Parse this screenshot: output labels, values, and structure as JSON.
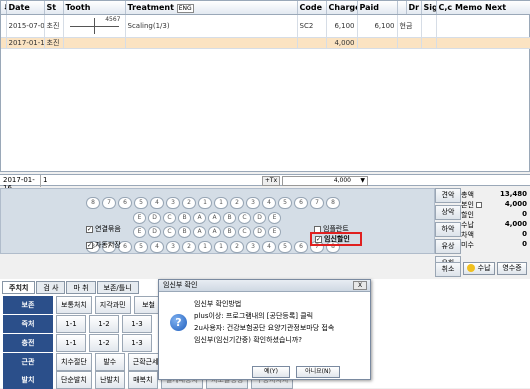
{
  "table": {
    "headers": {
      "arrow": "⬇",
      "date": "Date",
      "st": "St",
      "tooth": "Tooth",
      "treatment": "Treatment",
      "eng": "ENG",
      "code": "Code",
      "charge": "Charge",
      "paid": "Paid",
      "dr": "Dr",
      "sign": "Sign",
      "memo": "C,c Memo Next"
    },
    "rows": [
      {
        "date": "2015-07-06",
        "st": "초진",
        "tooth_num": "4567",
        "treatment": "Scaling(1/3)",
        "code": "SC2",
        "charge": "6,100",
        "paid": "6,100",
        "pay_method": "현금"
      },
      {
        "date": "2017-01-16",
        "st": "초진",
        "tooth_num": "",
        "treatment": "",
        "code": "",
        "charge": "4,000",
        "paid": "",
        "pay_method": ""
      }
    ]
  },
  "input_row": {
    "date": "2017-01-16",
    "count": "1",
    "tx_button": "+Tx",
    "amount": "4,000"
  },
  "chart": {
    "upper_teeth": [
      "8",
      "7",
      "6",
      "5",
      "4",
      "3",
      "2",
      "1",
      "1",
      "2",
      "3",
      "4",
      "5",
      "6",
      "7",
      "8"
    ],
    "upper_primary": [
      "E",
      "D",
      "C",
      "B",
      "A",
      "A",
      "B",
      "C",
      "D",
      "E"
    ],
    "lower_primary": [
      "E",
      "D",
      "C",
      "B",
      "A",
      "A",
      "B",
      "C",
      "D",
      "E"
    ],
    "lower_teeth": [
      "8",
      "7",
      "6",
      "5",
      "4",
      "3",
      "2",
      "1",
      "1",
      "2",
      "3",
      "4",
      "5",
      "6",
      "7",
      "8"
    ],
    "check_continuous": "연결묶음",
    "check_autosave": "자동저장",
    "check_implant": "임플란트",
    "check_pregnancy": "임신할인"
  },
  "side_buttons": [
    "견악",
    "상악",
    "하악",
    "유상",
    "유하",
    "취소"
  ],
  "totals": [
    {
      "label": "총액",
      "value": "13,480"
    },
    {
      "label": "본인",
      "value": "4,000"
    },
    {
      "label": "할인",
      "value": "0"
    },
    {
      "label": "수납",
      "value": "4,000"
    },
    {
      "label": "차액",
      "value": "0"
    },
    {
      "label": "미수",
      "value": "0"
    }
  ],
  "bottom_buttons": {
    "pay": "수납",
    "receipt": "영수증"
  },
  "tabs": [
    "주치치",
    "검 사",
    "마 취",
    "보존/틀니"
  ],
  "categories": [
    {
      "label": "보존",
      "buttons": [
        "보통처치",
        "지각과민",
        "보철"
      ]
    },
    {
      "label": "즉처",
      "buttons": [
        "1-1",
        "1-2",
        "1-3"
      ]
    },
    {
      "label": "충전",
      "buttons": [
        "1-1",
        "1-2",
        "1-3"
      ]
    },
    {
      "label": "근관",
      "buttons": [
        "치수절단",
        "발수",
        "근확근세"
      ]
    },
    {
      "label": "발치",
      "buttons": [
        "단순발치",
        "난발치",
        "매복치",
        "절개배농치",
        "치조골성형",
        "구동치치치"
      ]
    }
  ],
  "dialog": {
    "title": "임신부 확인",
    "close": "X",
    "icon": "?",
    "lines": [
      "임신부 확인방법",
      "plus이상: 프로그램내의 [공단등록] 클릭",
      "2u사용자: 건강보험공단 요양기관정보마당 접속",
      "임신부(임신기간중) 확인하셨습니까?"
    ],
    "yes": "예(Y)",
    "no": "아니요(N)"
  }
}
